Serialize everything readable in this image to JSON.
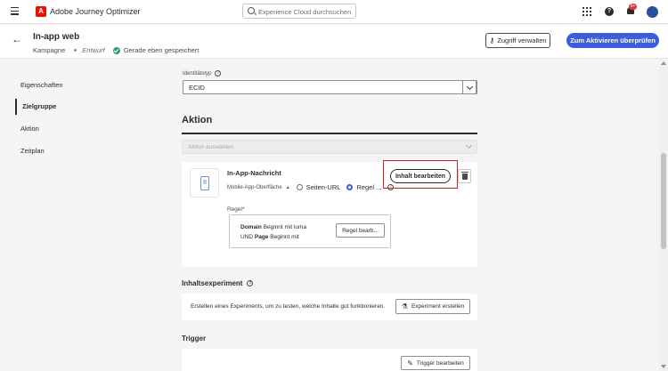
{
  "topbar": {
    "app_name": "Adobe Journey Optimizer",
    "logo_letter": "A",
    "search_placeholder": "Experience Cloud durchsuchen ...",
    "help_label": "?",
    "notification_count": "9+"
  },
  "campaign": {
    "title": "In-app web",
    "type": "Kampagne",
    "status": "Entwurf",
    "save_status": "Gerade eben gespeichert",
    "manage_access_label": "Zugriff verwalten",
    "activate_label": "Zum Aktivieren überprüfen"
  },
  "nav": {
    "items": [
      {
        "label": "Eigenschaften",
        "active": false
      },
      {
        "label": "Zielgruppe",
        "active": true
      },
      {
        "label": "Aktion",
        "active": false
      },
      {
        "label": "Zeitplan",
        "active": false
      }
    ]
  },
  "audience": {
    "identity_type_label": "Identitätstyp",
    "identity_type_value": "ECID"
  },
  "action": {
    "heading": "Aktion",
    "select_placeholder": "Aktion auswählen",
    "card": {
      "title": "In-App-Nachricht",
      "surface_label": "Mobile-App-Oberfläche",
      "option_page_url": "Seiten-URL",
      "option_rule": "Regel ...",
      "edit_content_label": "Inhalt bearbeiten",
      "rule_label": "Regel*",
      "rule_line1_key": "Domain",
      "rule_line1_rest": " Beginnt mit luma",
      "rule_line2_prefix": "UND ",
      "rule_line2_key": "Page",
      "rule_line2_rest": " Beginnt mit",
      "edit_rule_label": "Regel bearb..."
    }
  },
  "experiment": {
    "heading": "Inhaltsexperiment",
    "description": "Erstellen eines Experiments, um zu testen, welche Inhalte gut funktionieren.",
    "create_label": "Experiment erstellen"
  },
  "trigger": {
    "heading": "Trigger",
    "edit_label": "Trigger bearbeiten"
  },
  "colors": {
    "primary": "#3a5fd9",
    "brand": "#eb1000",
    "highlight": "#c9252d",
    "success": "#2d9d78"
  }
}
